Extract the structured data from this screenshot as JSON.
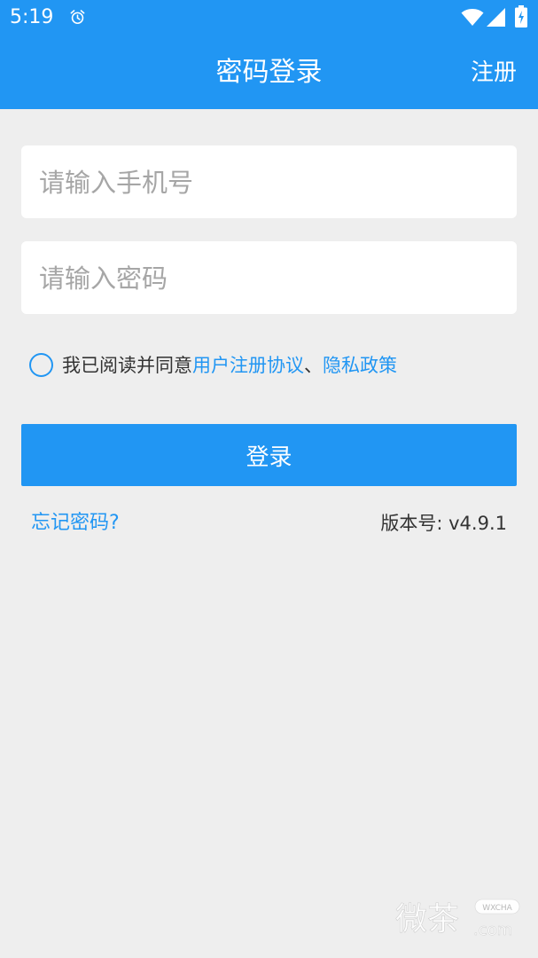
{
  "status_bar": {
    "time": "5:19",
    "icons": [
      "alarm-icon",
      "wifi-icon",
      "cell-signal-icon",
      "battery-icon"
    ]
  },
  "header": {
    "title": "密码登录",
    "register_label": "注册"
  },
  "form": {
    "phone_placeholder": "请输入手机号",
    "phone_value": "",
    "password_placeholder": "请输入密码",
    "password_value": ""
  },
  "agreement": {
    "prefix": "我已阅读并同意",
    "user_agreement": "用户注册协议",
    "separator": "、",
    "privacy_policy": "隐私政策",
    "checked": false
  },
  "login_label": "登录",
  "forgot_label": "忘记密码?",
  "version_label": "版本号: v4.9.1",
  "watermark": {
    "text": "微茶",
    "badge": "WXCHA",
    "suffix": ".com"
  },
  "colors": {
    "primary": "#2196f3",
    "background": "#eeeeee",
    "text": "#333333",
    "placeholder": "#a6a6a6"
  }
}
